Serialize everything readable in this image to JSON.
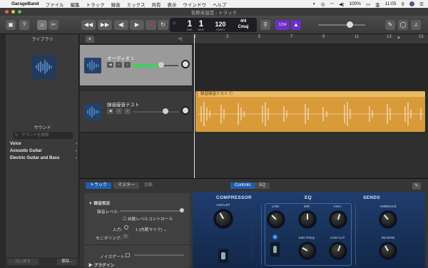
{
  "menubar": {
    "app": "GarageBand",
    "items": [
      "ファイル",
      "編集",
      "トラック",
      "録音",
      "ミックス",
      "共有",
      "表示",
      "ウインドウ",
      "ヘルプ"
    ],
    "battery": "100%",
    "day": "金",
    "time": "11:05"
  },
  "window": {
    "title": "名称未設定 - トラック"
  },
  "lcd": {
    "bar": "1",
    "beat": "1",
    "bar_label": "BAR",
    "beat_label": "BEAT",
    "tempo": "120",
    "tempo_label": "TEMPO",
    "timesig": "4/4",
    "key": "Cmaj"
  },
  "toolbar": {
    "count_in": "1234"
  },
  "library": {
    "title": "ライブラリ",
    "sound_title": "サウンド",
    "search_placeholder": "サウンドを検索",
    "items": [
      "Voice",
      "Acoustic Guitar",
      "Electric Guitar and Bass"
    ],
    "revert": "元に戻す",
    "save": "保存..."
  },
  "tracks": [
    {
      "name": "オーディオ 1",
      "volume": 0.62
    },
    {
      "name": "録音疑音テスト",
      "volume": 0.72
    }
  ],
  "ruler": [
    "1",
    "3",
    "5",
    "7",
    "9",
    "11",
    "13",
    "15"
  ],
  "region": {
    "label": "録音疑音テスト"
  },
  "smart": {
    "tabs": [
      "トラック",
      "マスター",
      "比較"
    ],
    "view_tabs": [
      "Controls",
      "EQ"
    ],
    "inspector": {
      "section": "録音設定",
      "level_label": "録音レベル:",
      "auto_level": "自動レベルコントロール",
      "input_label": "入力:",
      "input_value": "1 (内蔵マイク)",
      "monitor_label": "モニタリング:",
      "noise_gate_label": "ノイズゲート:",
      "plugins_label": "プラグイン"
    },
    "plugin": {
      "sections": [
        "COMPRESSOR",
        "EQ",
        "SENDS"
      ],
      "knobs": {
        "amount": "AMOUNT",
        "low": "LOW",
        "mid": "MID",
        "high": "HIGH",
        "mid_freq": "MID FREQ",
        "low_cut": "LOW CUT",
        "ambience": "AMBIENCE",
        "reverb": "REVERB"
      }
    }
  }
}
